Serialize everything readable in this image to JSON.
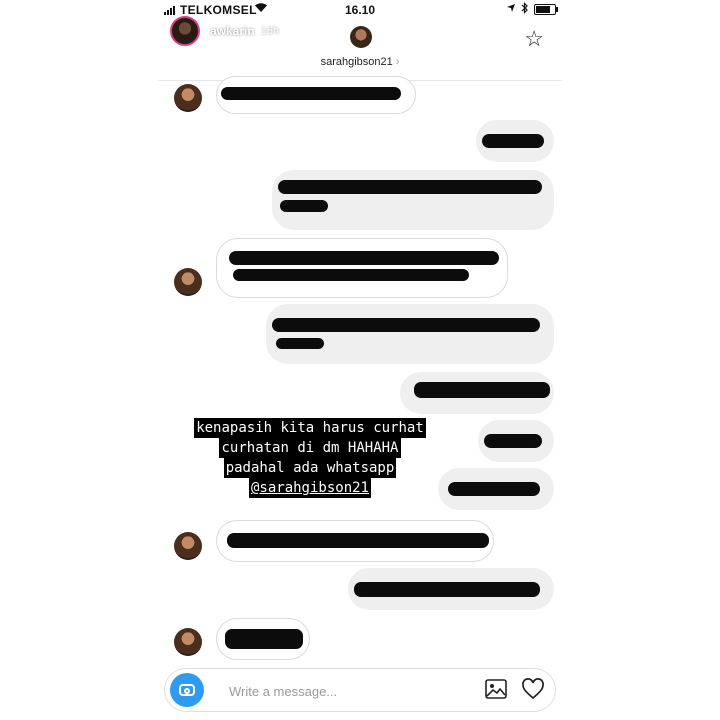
{
  "status_bar": {
    "carrier": "TELKOMSEL",
    "time": "16.10",
    "icons": [
      "signal-icon",
      "wifi-icon",
      "location-icon",
      "bluetooth-icon",
      "battery-icon"
    ]
  },
  "story": {
    "owner_name": "awkarin",
    "elapsed": "16h"
  },
  "chat": {
    "username": "sarahgibson21",
    "chevron": "›",
    "star_glyph": "☆"
  },
  "caption_lines": [
    "kenapasih kita harus curhat",
    "curhatan di dm HAHAHA",
    "padahal ada whatsapp",
    "@sarahgibson21"
  ],
  "composer": {
    "placeholder": "Write a message..."
  },
  "colors": {
    "camera_button": "#2f9bf0",
    "incoming_bubble_border": "#dadada",
    "outgoing_bubble_bg": "#efefef",
    "redaction": "#0c0c0c"
  }
}
